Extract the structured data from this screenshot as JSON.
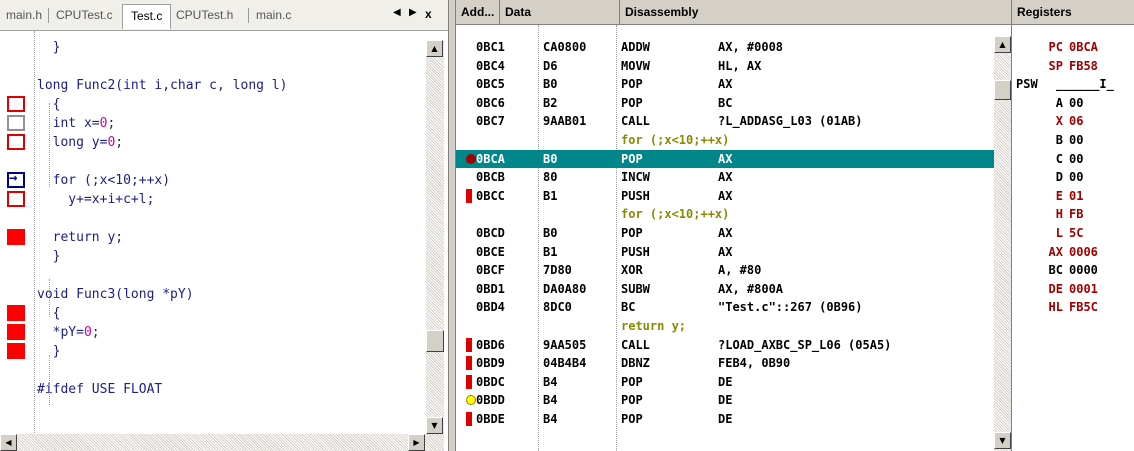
{
  "editor": {
    "tabs": [
      "main.h",
      "CPUTest.c",
      "Test.c",
      "CPUTest.h",
      "main.c"
    ],
    "active_tab": "Test.c",
    "tab_controls": {
      "prev": "◀",
      "next": "▶",
      "close": "x"
    },
    "lines": [
      {
        "text": "  }",
        "marker": "none"
      },
      {
        "text": "",
        "marker": "none"
      },
      {
        "text": "long Func2(int i,char c, long l)",
        "marker": "none"
      },
      {
        "text": "  {",
        "marker": "hollow"
      },
      {
        "text": "  int x=0;",
        "marker": "hollowgray"
      },
      {
        "text": "  long y=0;",
        "marker": "hollow"
      },
      {
        "text": "",
        "marker": "none"
      },
      {
        "text": "  for (;x<10;++x)",
        "marker": "arrow"
      },
      {
        "text": "    y+=x+i+c+l;",
        "marker": "hollow"
      },
      {
        "text": "",
        "marker": "none"
      },
      {
        "text": "  return y;",
        "marker": "solid"
      },
      {
        "text": "  }",
        "marker": "none"
      },
      {
        "text": "",
        "marker": "none"
      },
      {
        "text": "void Func3(long *pY)",
        "marker": "none"
      },
      {
        "text": "  {",
        "marker": "solid"
      },
      {
        "text": "  *pY=0;",
        "marker": "solid"
      },
      {
        "text": "  }",
        "marker": "solid"
      },
      {
        "text": "",
        "marker": "none"
      },
      {
        "text": "#ifdef USE FLOAT",
        "marker": "none"
      }
    ]
  },
  "disasm": {
    "headers": {
      "addr": "Add...",
      "data": "Data",
      "disasm": "Disassembly"
    },
    "rows": [
      {
        "addr": "0BC1",
        "data": "CA0800",
        "op": "ADDW",
        "args": "AX, #0008",
        "kind": "code",
        "mark": ""
      },
      {
        "addr": "0BC4",
        "data": "D6",
        "op": "MOVW",
        "args": "HL, AX",
        "kind": "code",
        "mark": ""
      },
      {
        "addr": "0BC5",
        "data": "B0",
        "op": "POP",
        "args": "AX",
        "kind": "code",
        "mark": ""
      },
      {
        "addr": "0BC6",
        "data": "B2",
        "op": "POP",
        "args": "BC",
        "kind": "code",
        "mark": ""
      },
      {
        "addr": "0BC7",
        "data": "9AAB01",
        "op": "CALL",
        "args": "?L_ADDASG_L03 (01AB)",
        "kind": "code",
        "mark": ""
      },
      {
        "src": "for (;x<10;++x)",
        "kind": "src"
      },
      {
        "addr": "0BCA",
        "data": "B0",
        "op": "POP",
        "args": "AX",
        "kind": "current",
        "mark": "dot"
      },
      {
        "addr": "0BCB",
        "data": "80",
        "op": "INCW",
        "args": "AX",
        "kind": "code",
        "mark": ""
      },
      {
        "addr": "0BCC",
        "data": "B1",
        "op": "PUSH",
        "args": "AX",
        "kind": "code",
        "mark": "bp"
      },
      {
        "src": "for (;x<10;++x)",
        "kind": "src"
      },
      {
        "addr": "0BCD",
        "data": "B0",
        "op": "POP",
        "args": "AX",
        "kind": "code",
        "mark": ""
      },
      {
        "addr": "0BCE",
        "data": "B1",
        "op": "PUSH",
        "args": "AX",
        "kind": "code",
        "mark": ""
      },
      {
        "addr": "0BCF",
        "data": "7D80",
        "op": "XOR",
        "args": "A, #80",
        "kind": "code",
        "mark": ""
      },
      {
        "addr": "0BD1",
        "data": "DA0A80",
        "op": "SUBW",
        "args": "AX, #800A",
        "kind": "code",
        "mark": ""
      },
      {
        "addr": "0BD4",
        "data": "8DC0",
        "op": "BC",
        "args": "\"Test.c\"::267 (0B96)",
        "kind": "code",
        "mark": ""
      },
      {
        "src": "return y;",
        "kind": "src"
      },
      {
        "addr": "0BD6",
        "data": "9AA505",
        "op": "CALL",
        "args": "?LOAD_AXBC_SP_L06 (05A5)",
        "kind": "code",
        "mark": "bp"
      },
      {
        "addr": "0BD9",
        "data": "04B4B4",
        "op": "DBNZ",
        "args": "FEB4, 0B90",
        "kind": "code",
        "mark": "bp"
      },
      {
        "addr": "0BDC",
        "data": "B4",
        "op": "POP",
        "args": "DE",
        "kind": "code",
        "mark": "bp"
      },
      {
        "addr": "0BDD",
        "data": "B4",
        "op": "POP",
        "args": "DE",
        "kind": "code",
        "mark": "yellow"
      },
      {
        "addr": "0BDE",
        "data": "B4",
        "op": "POP",
        "args": "DE",
        "kind": "code",
        "mark": "bp"
      }
    ]
  },
  "registers": {
    "header": "Registers",
    "psw_label": "PSW",
    "psw_value": "______I_",
    "items": [
      {
        "name": "PC",
        "value": "0BCA",
        "changed": true
      },
      {
        "name": "SP",
        "value": "FB58",
        "changed": true
      },
      {
        "name": "A",
        "value": "00",
        "changed": false
      },
      {
        "name": "X",
        "value": "06",
        "changed": true
      },
      {
        "name": "B",
        "value": "00",
        "changed": false
      },
      {
        "name": "C",
        "value": "00",
        "changed": false
      },
      {
        "name": "D",
        "value": "00",
        "changed": false
      },
      {
        "name": "E",
        "value": "01",
        "changed": true
      },
      {
        "name": "H",
        "value": "FB",
        "changed": true
      },
      {
        "name": "L",
        "value": "5C",
        "changed": true
      },
      {
        "name": "AX",
        "value": "0006",
        "changed": true
      },
      {
        "name": "BC",
        "value": "0000",
        "changed": false
      },
      {
        "name": "DE",
        "value": "0001",
        "changed": true
      },
      {
        "name": "HL",
        "value": "FB5C",
        "changed": true
      }
    ]
  },
  "colors": {
    "current_line": "#00868b",
    "changed_register": "#a00000",
    "breakpoint": "#e00000",
    "source_line": "#8a8a00"
  }
}
